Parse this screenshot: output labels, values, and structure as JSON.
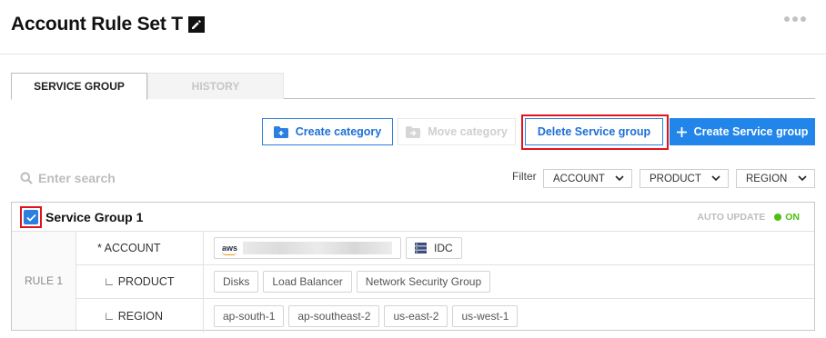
{
  "header": {
    "title": "Account Rule Set T"
  },
  "tabs": [
    {
      "label": "SERVICE GROUP",
      "active": true
    },
    {
      "label": "HISTORY",
      "active": false
    }
  ],
  "toolbar": {
    "create_category": "Create category",
    "move_category": "Move category",
    "delete_service_group": "Delete Service group",
    "create_service_group": "Create Service group"
  },
  "search": {
    "placeholder": "Enter search"
  },
  "filter": {
    "label": "Filter",
    "account": "ACCOUNT",
    "product": "PRODUCT",
    "region": "REGION"
  },
  "group": {
    "name": "Service Group 1",
    "checked": true,
    "auto_update_label": "AUTO UPDATE",
    "auto_update_state": "ON",
    "rule_label": "RULE 1",
    "rows": {
      "account": {
        "key": "* ACCOUNT",
        "aws_logo": "aws",
        "idc": "IDC"
      },
      "product": {
        "key": "∟ PRODUCT",
        "values": [
          "Disks",
          "Load Balancer",
          "Network Security Group"
        ]
      },
      "region": {
        "key": "∟ REGION",
        "values": [
          "ap-south-1",
          "ap-southeast-2",
          "us-east-2",
          "us-west-1"
        ]
      }
    }
  },
  "colors": {
    "primary": "#2185ea",
    "highlight": "#e0151b",
    "status_on": "#4cc00f"
  }
}
